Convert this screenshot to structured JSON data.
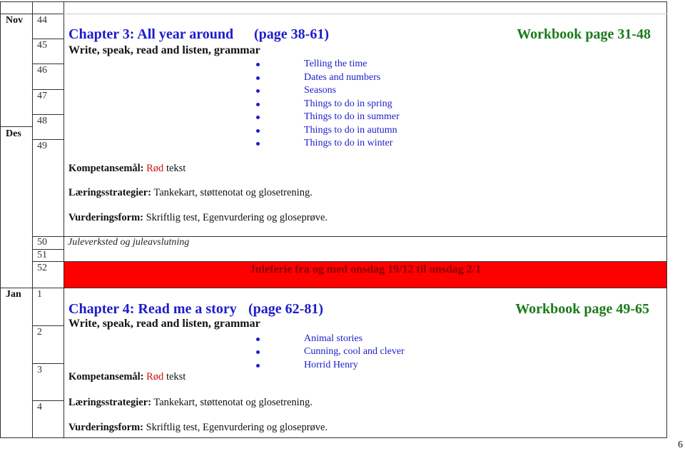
{
  "months": {
    "nov": "Nov",
    "des": "Des",
    "jan": "Jan"
  },
  "weeks": [
    "44",
    "45",
    "46",
    "47",
    "48",
    "49",
    "50",
    "51",
    "52",
    "1",
    "2",
    "3",
    "4"
  ],
  "chapter3": {
    "title": "Chapter 3: All year around",
    "pages": "(page 38-61)",
    "workbook": "Workbook page 31-48",
    "skills": "Write, speak, read and listen, grammar",
    "topics": [
      "Telling the time",
      "Dates and numbers",
      "Seasons",
      "Things to do in spring",
      "Things to do in summer",
      "Things to do in autumn",
      "Things to do in winter"
    ],
    "kompetanse_label": "Kompetansemål:",
    "kompetanse_red": "Rød",
    "kompetanse_rest": "tekst",
    "laering_label": "Læringsstrategier:",
    "laering_text": "Tankekart, støttenotat og glosetrening.",
    "vurdering_label": "Vurderingsform:",
    "vurdering_text": "Skriftlig test,  Egenvurdering og gloseprøve."
  },
  "week50_note": "Juleverksted og juleavslutning",
  "holiday": {
    "text": "Juleferie fra og med onsdag 19/12 til onsdag 2/1",
    "bg": "#ff0000",
    "color": "#8b0000"
  },
  "chapter4": {
    "title": "Chapter 4: Read me a story",
    "pages": "(page 62-81)",
    "workbook": "Workbook page 49-65",
    "skills": "Write, speak, read and listen, grammar",
    "topics": [
      "Animal stories",
      "Cunning, cool and clever",
      "Horrid Henry"
    ],
    "kompetanse_label": "Kompetansemål:",
    "kompetanse_red": "Rød",
    "kompetanse_rest": "tekst",
    "laering_label": "Læringsstrategier:",
    "laering_text": "Tankekart, støttenotat og glosetrening.",
    "vurdering_label": "Vurderingsform:",
    "vurdering_text": "Skriftlig test,  Egenvurdering og gloseprøve."
  },
  "page_number": "6",
  "colors": {
    "heading_blue": "#1c1ccc",
    "workbook_green": "#1a7a1a",
    "red_text": "#d01010"
  }
}
